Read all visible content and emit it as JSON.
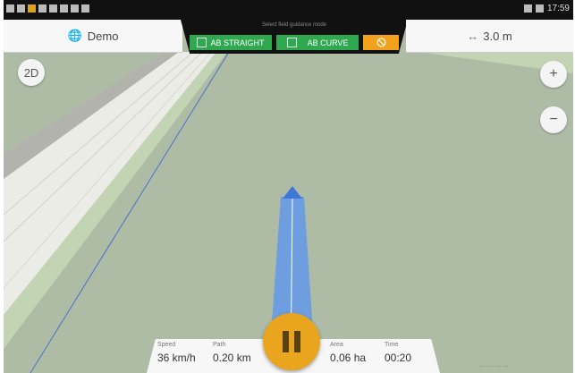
{
  "header": {
    "profile_label": "Demo",
    "width_label": "3.0 m",
    "mode_caption": "Select field guidance mode",
    "mode_ab_straight": "AB STRAIGHT",
    "mode_ab_curve": "AB CURVE"
  },
  "map_controls": {
    "view_2d": "2D",
    "zoom_in": "+",
    "zoom_out": "−"
  },
  "stats": [
    {
      "label": "Speed",
      "value": "36 km/h"
    },
    {
      "label": "Path",
      "value": "0.20 km"
    },
    {
      "label": "Area",
      "value": "0.06 ha"
    },
    {
      "label": "Time",
      "value": "00:20"
    }
  ],
  "statusbar": {
    "time": "17:59"
  },
  "colors": {
    "map_background": "#aebca6",
    "road": "#ecece6",
    "track": "#6e9ee0",
    "mode_green": "#2fa84f",
    "mode_orange": "#f2a21a",
    "pause": "#e8a51d"
  },
  "icons": {
    "profile": "globe-icon",
    "width": "width-arrows-icon",
    "cancel": "no-entry-icon",
    "pause": "pause-icon"
  }
}
